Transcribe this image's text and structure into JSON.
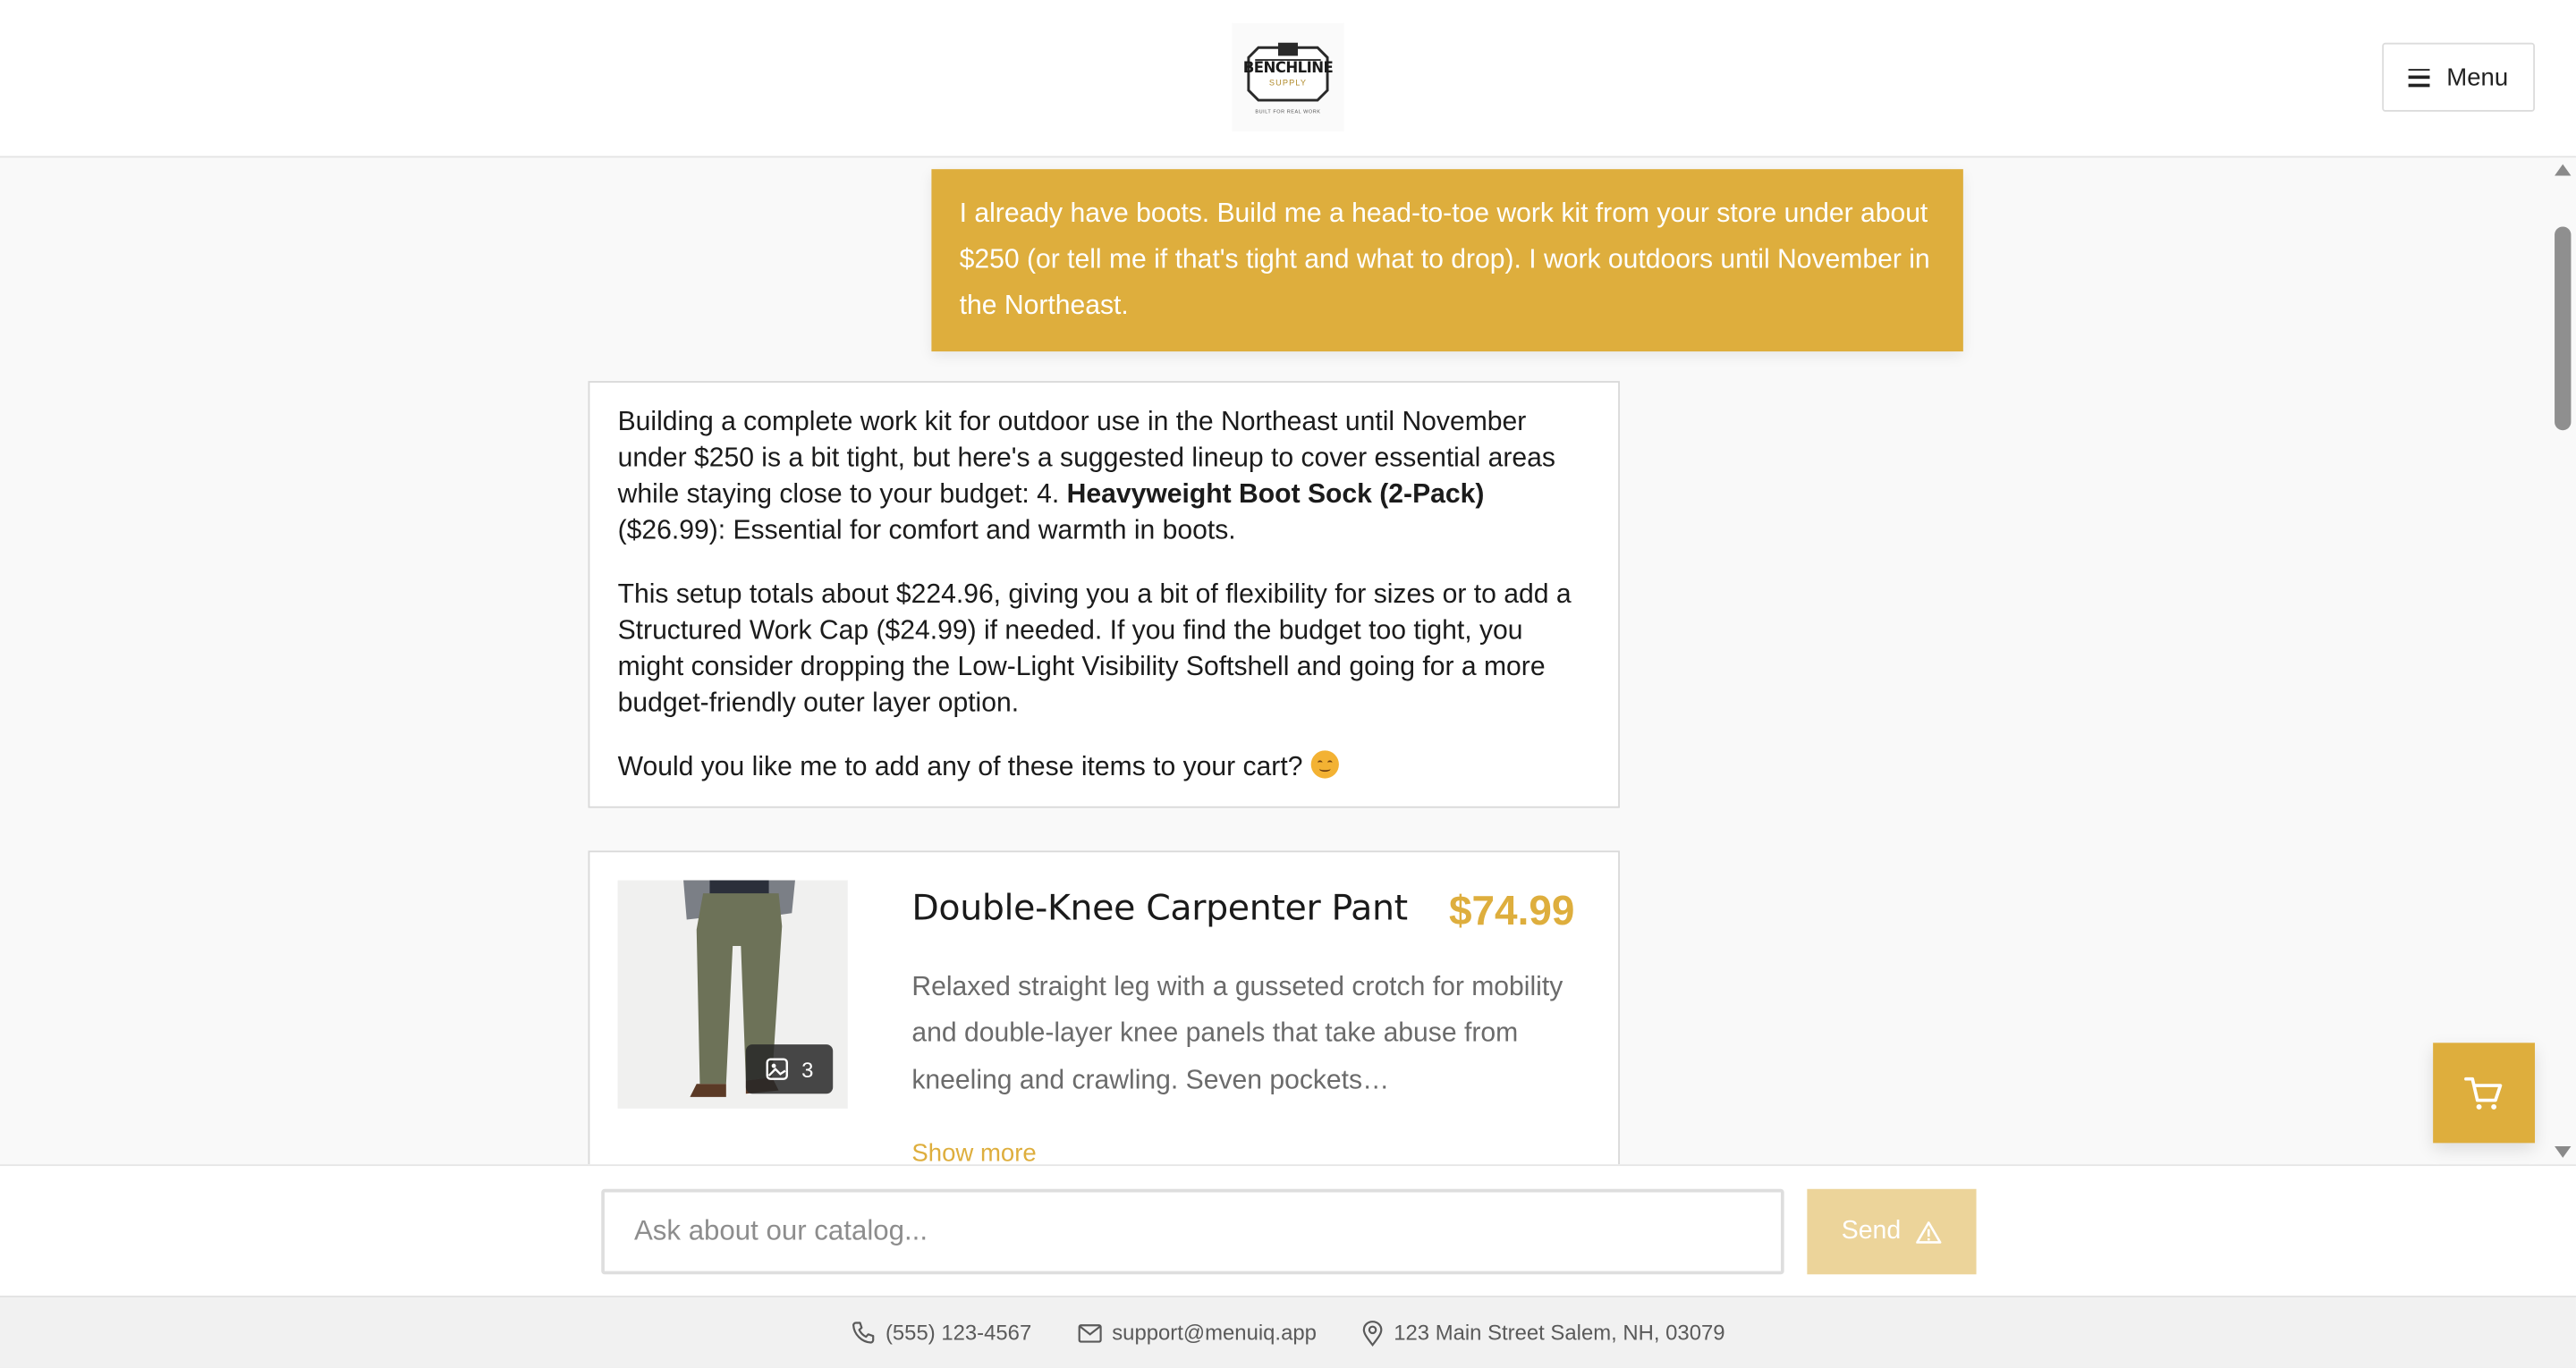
{
  "header": {
    "logo": {
      "name": "BENCHLINE",
      "sub": "SUPPLY",
      "est": "EST",
      "year": "2020",
      "tag": "BUILT FOR REAL WORK"
    },
    "menu_label": "Menu"
  },
  "chat": {
    "user_message": "I already have boots. Build me a head-to-toe work kit from your store under about $250 (or tell me if that's tight and what to drop). I work outdoors until November in the Northeast.",
    "bot_message": {
      "p1_before": "Building a complete work kit for outdoor use in the Northeast until November under $250 is a bit tight, but here's a suggested lineup to cover essential areas while staying close to your budget: 4. ",
      "p1_bold": "Heavyweight Boot Sock (2-Pack)",
      "p1_after": " ($26.99): Essential for comfort and warmth in boots.",
      "p2": "This setup totals about $224.96, giving you a bit of flexibility for sizes or to add a Structured Work Cap ($24.99) if needed. If you find the budget too tight, you might consider dropping the Low-Light Visibility Softshell and going for a more budget-friendly outer layer option.",
      "p3": "Would you like me to add any of these items to your cart? "
    },
    "product": {
      "name": "Double-Knee Carpenter Pant",
      "price": "$74.99",
      "description": "Relaxed straight leg with a gusseted crotch for mobility and double-layer knee panels that take abuse from kneeling and crawling. Seven pockets…",
      "image_count": "3",
      "show_more": "Show more"
    }
  },
  "input": {
    "placeholder": "Ask about our catalog...",
    "value": "",
    "send_label": "Send"
  },
  "footer": {
    "phone": "(555) 123-4567",
    "email": "support@menuiq.app",
    "address": "123 Main Street Salem, NH, 03079"
  },
  "colors": {
    "accent": "#deae3d",
    "accent_light": "#ecd49a"
  },
  "icons": [
    "hamburger-icon",
    "image-icon",
    "cart-icon",
    "warning-icon",
    "phone-icon",
    "mail-icon",
    "location-pin-icon",
    "smile-emoji-icon"
  ]
}
